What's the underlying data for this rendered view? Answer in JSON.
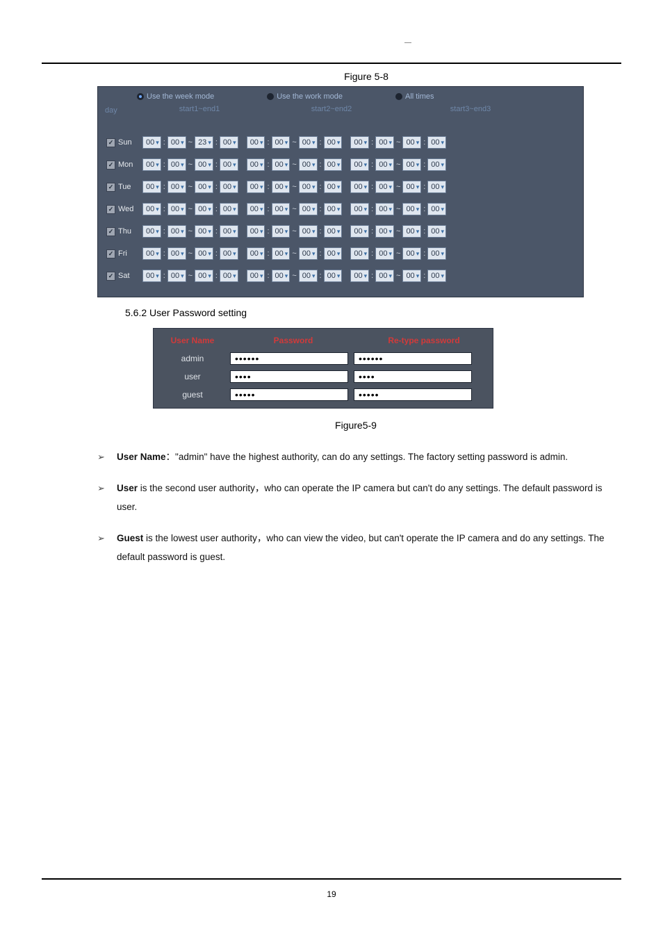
{
  "header": {
    "top_page_marker": "—",
    "caption_fig8": "Figure 5-8"
  },
  "schedule_panel": {
    "modes": [
      {
        "label": "Use the week mode",
        "selected": true
      },
      {
        "label": "Use the work mode",
        "selected": false
      },
      {
        "label": "All times",
        "selected": false
      }
    ],
    "day_label": "day",
    "range_labels": [
      "start1~end1",
      "start2~end2",
      "start3~end3"
    ],
    "days": [
      "Sun",
      "Mon",
      "Tue",
      "Wed",
      "Thu",
      "Fri",
      "Sat"
    ],
    "default_val": "00",
    "sun_end_hour": "23"
  },
  "user_section": {
    "title": "5.6.2 User Password setting",
    "fig_caption": "Figure5-9",
    "headers": {
      "user": "User Name",
      "pw": "Password",
      "re": "Re-type password"
    },
    "rows": [
      {
        "user": "admin",
        "pw": "••••••",
        "re": "••••••"
      },
      {
        "user": "user",
        "pw": "••••",
        "re": "••••"
      },
      {
        "user": "guest",
        "pw": "•••••",
        "re": "•••••"
      }
    ]
  },
  "bullets": {
    "b1": {
      "label": "User Name",
      "text": "：\"admin\" have the highest authority, can do any settings. The factory setting password is admin."
    },
    "b2": {
      "label": "User",
      "text": " is the second user authority，who can operate the IP camera but can't do any settings. The default password is user."
    },
    "b3": {
      "label": "Guest",
      "text": " is the lowest user authority，who can view the video, but can't operate the IP camera and do any settings. The default password is guest."
    }
  },
  "footer": {
    "page": "19"
  }
}
